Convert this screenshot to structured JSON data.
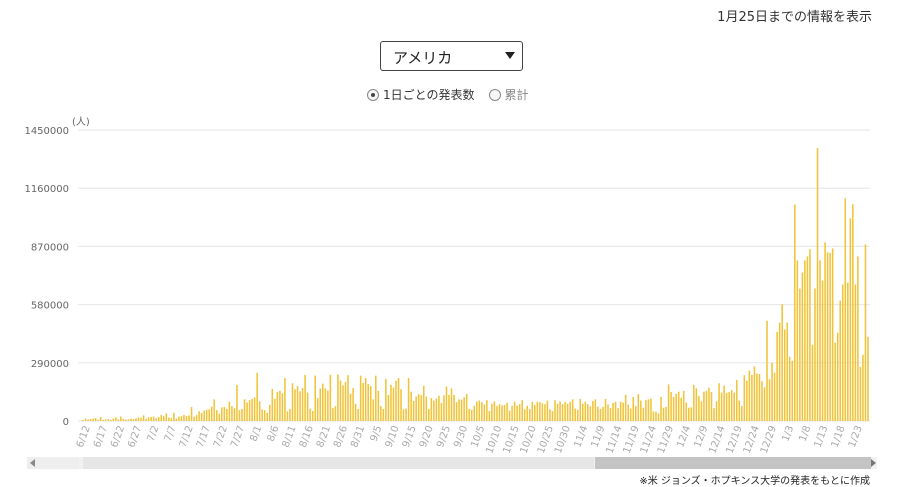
{
  "header": {
    "as_of": "1月25日までの情報を表示"
  },
  "country_select": {
    "value": "アメリカ"
  },
  "mode": {
    "daily_label": "1日ごとの発表数",
    "cumulative_label": "累計",
    "selected": "daily"
  },
  "source_note": "※米 ジョンズ・ホプキンス大学の発表をもとに作成",
  "colors": {
    "bar": "#f0c43a",
    "grid": "#e6e6e6",
    "axis_text": "#666666",
    "tick_label": "#aaaaaa"
  },
  "chart_data": {
    "type": "bar",
    "unit_label": "(人)",
    "ylim": [
      0,
      1450000
    ],
    "yticks": [
      0,
      290000,
      580000,
      870000,
      1160000,
      1450000
    ],
    "grid": true,
    "xtick_labels": [
      "6/12",
      "6/17",
      "6/22",
      "6/27",
      "7/2",
      "7/7",
      "7/12",
      "7/17",
      "7/22",
      "7/27",
      "8/1",
      "8/6",
      "8/11",
      "8/16",
      "8/21",
      "8/26",
      "8/31",
      "9/5",
      "9/10",
      "9/15",
      "9/20",
      "9/25",
      "9/30",
      "10/5",
      "10/10",
      "10/15",
      "10/20",
      "10/25",
      "10/30",
      "11/4",
      "11/9",
      "11/14",
      "11/19",
      "11/24",
      "11/29",
      "12/4",
      "12/9",
      "12/14",
      "12/19",
      "12/24",
      "12/29",
      "1/3",
      "1/8",
      "1/13",
      "1/18",
      "1/23"
    ],
    "values": [
      5000,
      12000,
      8000,
      10000,
      12000,
      15000,
      6000,
      20000,
      5000,
      8000,
      10000,
      6000,
      12000,
      18000,
      8000,
      22000,
      10000,
      6000,
      8000,
      12000,
      10000,
      14000,
      18000,
      16000,
      28000,
      12000,
      18000,
      20000,
      22000,
      14000,
      20000,
      30000,
      24000,
      38000,
      18000,
      14000,
      40000,
      12000,
      22000,
      24000,
      30000,
      26000,
      28000,
      70000,
      22000,
      30000,
      48000,
      40000,
      52000,
      56000,
      58000,
      72000,
      108000,
      54000,
      36000,
      68000,
      70000,
      60000,
      96000,
      74000,
      64000,
      180000,
      54000,
      60000,
      108000,
      92000,
      104000,
      110000,
      118000,
      240000,
      98000,
      58000,
      54000,
      40000,
      80000,
      160000,
      110000,
      146000,
      150000,
      138000,
      214000,
      48000,
      60000,
      188000,
      158000,
      174000,
      148000,
      164000,
      230000,
      142000,
      62000,
      50000,
      226000,
      114000,
      162000,
      186000,
      162000,
      152000,
      230000,
      64000,
      74000,
      232000,
      202000,
      178000,
      194000,
      228000,
      136000,
      164000,
      86000,
      60000,
      226000,
      190000,
      214000,
      184000,
      174000,
      108000,
      226000,
      150000,
      74000,
      60000,
      210000,
      130000,
      180000,
      166000,
      200000,
      214000,
      158000,
      58000,
      62000,
      214000,
      146000,
      100000,
      122000,
      134000,
      128000,
      176000,
      122000,
      60000,
      114000,
      102000,
      112000,
      126000,
      90000,
      128000,
      172000,
      130000,
      162000,
      130000,
      94000,
      108000,
      106000,
      118000,
      134000,
      60000,
      56000,
      76000,
      96000,
      102000,
      94000,
      82000,
      104000,
      50000,
      86000,
      98000,
      74000,
      84000,
      78000,
      80000,
      90000,
      52000,
      76000,
      96000,
      76000,
      84000,
      104000,
      58000,
      76000,
      60000,
      96000,
      80000,
      96000,
      94000,
      88000,
      84000,
      102000,
      58000,
      50000,
      104000,
      86000,
      98000,
      84000,
      96000,
      86000,
      96000,
      108000,
      62000,
      56000,
      110000,
      86000,
      96000,
      84000,
      72000,
      100000,
      108000,
      72000,
      60000,
      70000,
      110000,
      82000,
      64000,
      90000,
      96000,
      64000,
      96000,
      92000,
      130000,
      82000,
      62000,
      120000,
      74000,
      134000,
      102000,
      66000,
      104000,
      108000,
      112000,
      48000,
      46000,
      38000,
      120000,
      66000,
      70000,
      182000,
      144000,
      120000,
      136000,
      146000,
      116000,
      150000,
      92000,
      66000,
      68000,
      180000,
      162000,
      124000,
      98000,
      146000,
      150000,
      166000,
      144000,
      64000,
      98000,
      188000,
      142000,
      176000,
      140000,
      144000,
      154000,
      142000,
      204000,
      102000,
      74000,
      228000,
      200000,
      252000,
      230000,
      272000,
      236000,
      234000,
      198000,
      168000,
      500000,
      208000,
      290000,
      240000,
      444000,
      490000,
      582000,
      456000,
      490000,
      320000,
      300000,
      1078000,
      800000,
      660000,
      740000,
      800000,
      820000,
      856000,
      380000,
      660000,
      1360000,
      800000,
      700000,
      890000,
      840000,
      838000,
      860000,
      390000,
      440000,
      600000,
      680000,
      1110000,
      690000,
      1010000,
      1080000,
      680000,
      820000,
      270000,
      330000,
      880000,
      420000
    ]
  }
}
